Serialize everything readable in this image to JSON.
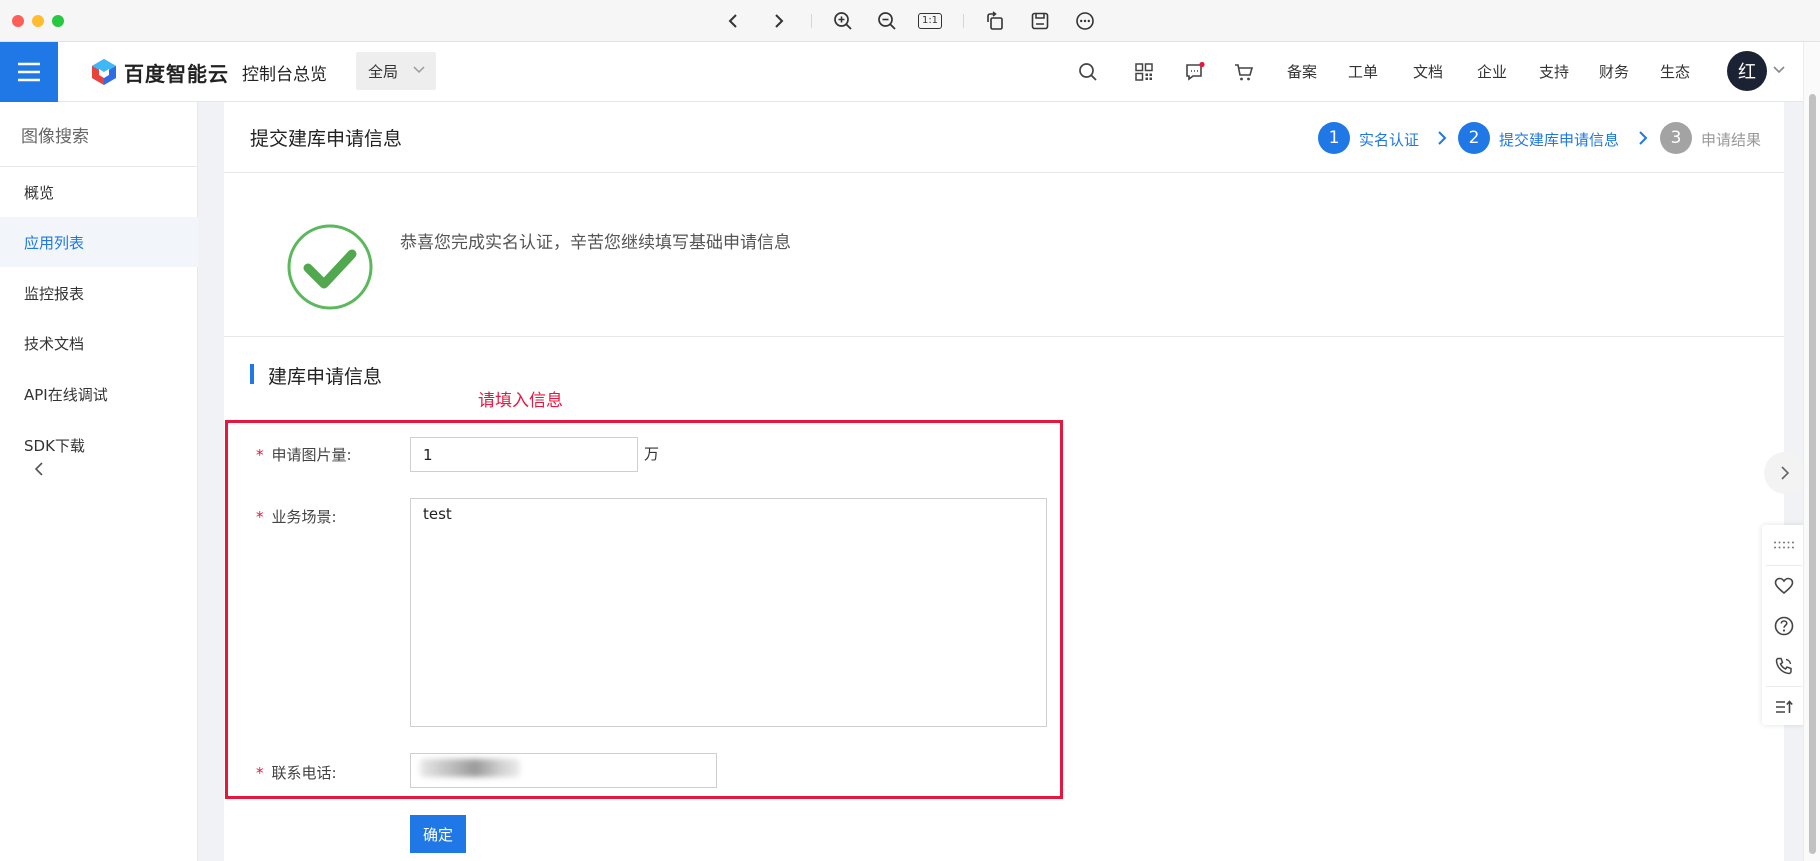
{
  "window": {
    "toolbar_icons": [
      "back-icon",
      "forward-icon",
      "zoom-in-icon",
      "zoom-out-icon",
      "actual-size-icon",
      "rotate-icon",
      "save-icon",
      "more-icon"
    ],
    "actual_size_label": "1:1"
  },
  "topnav": {
    "logo_text": "百度智能云",
    "console_title": "控制台总览",
    "region": "全局",
    "links": [
      "备案",
      "工单",
      "文档",
      "企业",
      "支持",
      "财务",
      "生态"
    ],
    "avatar": "红",
    "colors": {
      "brand": "#1f78e6",
      "notify_dot": "#e8163e"
    }
  },
  "sidebar": {
    "title": "图像搜索",
    "items": [
      {
        "label": "概览",
        "active": false
      },
      {
        "label": "应用列表",
        "active": true
      },
      {
        "label": "监控报表",
        "active": false
      },
      {
        "label": "技术文档",
        "active": false
      },
      {
        "label": "API在线调试",
        "active": false
      },
      {
        "label": "SDK下载",
        "active": false
      }
    ]
  },
  "page": {
    "title": "提交建库申请信息",
    "steps": [
      {
        "num": "1",
        "label": "实名认证",
        "state": "done"
      },
      {
        "num": "2",
        "label": "提交建库申请信息",
        "state": "current"
      },
      {
        "num": "3",
        "label": "申请结果",
        "state": "todo"
      }
    ],
    "success_message": "恭喜您完成实名认证，辛苦您继续填写基础申请信息",
    "section_title": "建库申请信息",
    "annotation": "请填入信息",
    "form": {
      "image_count": {
        "label": "申请图片量:",
        "value": "1",
        "unit": "万",
        "required": "*"
      },
      "scenario": {
        "label": "业务场景:",
        "value": "test",
        "required": "*"
      },
      "phone": {
        "label": "联系电话:",
        "value": "",
        "required": "*"
      }
    },
    "submit_label": "确定"
  },
  "float_toolbar": [
    "drag-handle-icon",
    "heart-icon",
    "help-icon",
    "phone-icon",
    "list-top-icon"
  ]
}
